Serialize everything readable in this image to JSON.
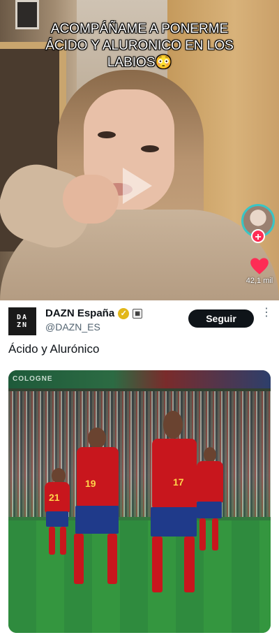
{
  "video": {
    "caption": "ACOMPÁÑAME A PONERME ÁCIDO Y ALURONICO EN LOS LABIOS😳",
    "likes": "42,1 mil"
  },
  "tweet": {
    "account_name": "DAZN España",
    "handle": "@DAZN_ES",
    "avatar_text_top": "DA",
    "avatar_text_bottom": "ZN",
    "follow_label": "Seguir",
    "more_label": "⋮",
    "text": "Ácido y Alurónico",
    "photo": {
      "banner_text": "COLOGNE",
      "jersey_numbers": [
        "21",
        "19",
        "17"
      ]
    }
  }
}
